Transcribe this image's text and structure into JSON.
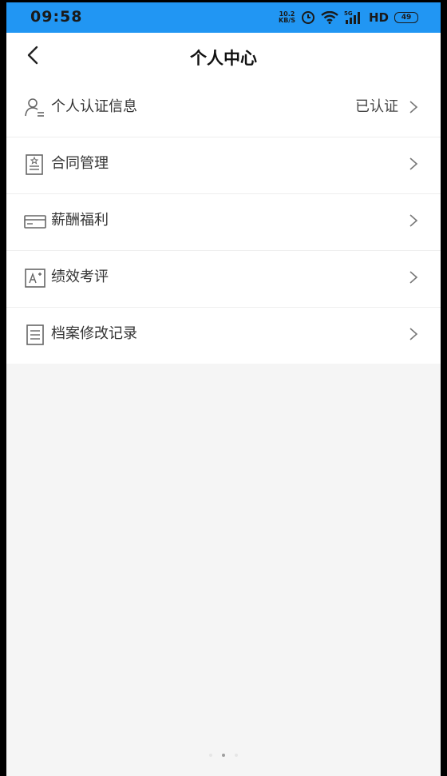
{
  "status_bar": {
    "time": "09:58",
    "net_speed_value": "10.2",
    "net_speed_unit": "KB/S",
    "signal_label": "5G",
    "hd_label": "HD",
    "battery_level": "49",
    "icons": [
      "alarm-icon",
      "wifi-icon",
      "signal-icon",
      "battery-icon"
    ]
  },
  "header": {
    "title": "个人中心",
    "back_icon": "back-arrow-icon"
  },
  "menu": {
    "items": [
      {
        "id": "personal-certification",
        "label": "个人认证信息",
        "value": "已认证",
        "icon": "person-id-icon"
      },
      {
        "id": "contract-management",
        "label": "合同管理",
        "value": "",
        "icon": "contract-icon"
      },
      {
        "id": "salary-benefits",
        "label": "薪酬福利",
        "value": "",
        "icon": "card-icon"
      },
      {
        "id": "performance-review",
        "label": "绩效考评",
        "value": "",
        "icon": "grade-icon"
      },
      {
        "id": "archive-change-log",
        "label": "档案修改记录",
        "value": "",
        "icon": "document-list-icon"
      }
    ]
  },
  "colors": {
    "status_bar": "#2196f3",
    "background": "#f5f5f5",
    "card": "#ffffff",
    "text_primary": "#333333"
  }
}
